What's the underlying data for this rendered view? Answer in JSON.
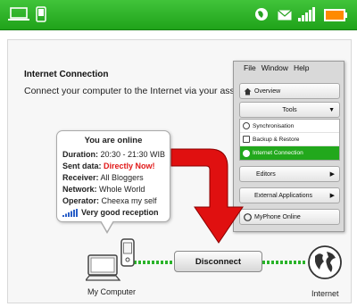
{
  "header": {
    "icons": [
      "laptop-icon",
      "phone-icon",
      "globe-icon",
      "mail-icon",
      "signal-icon",
      "battery-icon"
    ],
    "brand_color": "#2bb527",
    "battery_color": "#ff8a00"
  },
  "main": {
    "title": "Internet Connection",
    "subtitle": "Connect your computer to the Internet via your ass."
  },
  "status": {
    "heading": "You are online",
    "rows": [
      {
        "label": "Duration:",
        "value": "20:30 - 21:30 WIB"
      },
      {
        "label": "Sent data:",
        "value": "Directly Now!"
      },
      {
        "label": "Receiver:",
        "value": "All Bloggers"
      },
      {
        "label": "Network:",
        "value": "Whole World"
      },
      {
        "label": "Operator:",
        "value": "Cheexa my self"
      }
    ],
    "reception": "Very good reception",
    "sent_color": "#e01818"
  },
  "menu": {
    "menubar": [
      "File",
      "Window",
      "Help"
    ],
    "overview": "Overview",
    "tools": "Tools",
    "tools_items": [
      {
        "label": "Synchronisation",
        "icon": "sync-icon",
        "active": false
      },
      {
        "label": "Backup & Restore",
        "icon": "backup-icon",
        "active": false
      },
      {
        "label": "Internet Connection",
        "icon": "internet-icon",
        "active": true
      }
    ],
    "editors": "Editors",
    "external": "External Applications",
    "myphone": "MyPhone Online"
  },
  "bottom": {
    "disconnect": "Disconnect",
    "my_computer": "My Computer",
    "internet": "Internet"
  }
}
